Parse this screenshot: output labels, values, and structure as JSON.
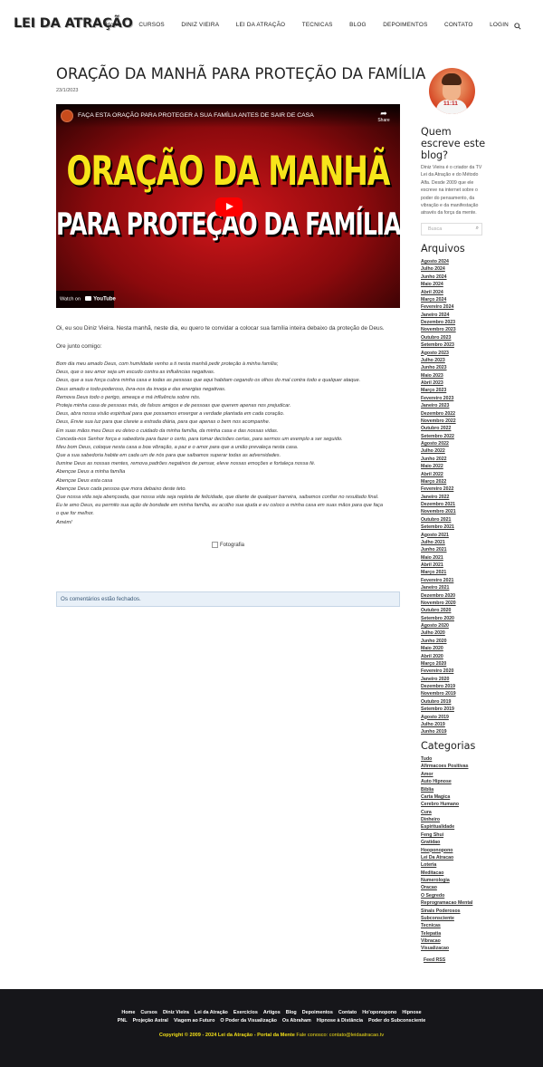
{
  "header": {
    "logo": "LEI DA ATRAÇÃO",
    "nav": [
      "Home",
      "CURSOS",
      "DINIZ VIEIRA",
      "LEI DA ATRAÇÃO",
      "TECNICAS",
      "BLOG",
      "DEPOIMENTOS",
      "CONTATO",
      "LOGIN"
    ],
    "search_icon": "search-icon"
  },
  "post": {
    "title": "ORAÇÃO DA MANHÃ PARA PROTEÇÃO DA FAMÍLIA",
    "date": "23/1/2023",
    "video": {
      "caption": "FAÇA ESTA ORAÇÃO PARA PROTEGER A SUA FAMÍLIA ANTES DE SAIR DE CASA",
      "share_label": "Share",
      "thumb_line1": "ORAÇÃO DA MANHÃ",
      "thumb_line2": "PARA PROTEÇAO DA FAMÍLIA",
      "watch_on": "Watch on",
      "youtube": "YouTube"
    },
    "intro": "Oi, eu sou Diniz Vieira. Nesta manhã, neste dia, eu quero te convidar a colocar sua família inteira debaixo da proteção de Deus.",
    "intro2": "Ore junto comigo:",
    "prayer": [
      "Bom dia meu amado Deus, com humildade venho a ti nesta manhã pedir proteção à minha família;",
      "Deus, que o seu amor seja um escudo contra as influências negativas.",
      "Deus, que a sua força cubra minha casa e todas as pessoas que aqui habitam cegando os olhos do mal contra todo e qualquer ataque.",
      "Deus amado e todo-poderoso, livra-nos da inveja e das energias negativas.",
      "Remova Deus todo o perigo, ameaça e má influência sobre nós.",
      "Proteja minha casa de pessoas más, de falsos amigos e de pessoas que querem apenas nos prejudicar.",
      "Deus, abra nossa visão espiritual para que possamos enxergar a verdade plantada em cada coração.",
      "Deus, Envie sua luz para que clareie a estrada diária, para que apenas o bem nos acompanhe.",
      "Em suas mãos meu Deus eu deixo o cuidado da minha família, da minha casa e das nossas vidas.",
      "Conceda-nos Senhor força e sabedoria para fazer o certo, para tomar decisões certas, para sermos um exemplo a ser seguido.",
      "Meu bom Deus, coloque nesta casa a boa vibração, a paz e o amor para que a união prevaleça nesta casa.",
      "Que a sua sabedoria habite em cada um de nós para que saibamos superar todas as adversidades.",
      "Ilumine Deus as nossas mentes, remova padrões negativos de pensar, eleve nossas emoções e fortaleça nossa fé.",
      "Abençoe Deus a minha família",
      "Abençoe Deus esta casa",
      "Abençoe Deus cada pessoa que mora debaixo deste teto.",
      "Que nossa vida seja abençoada, que nossa vida seja repleta de felicidade, que diante de qualquer barreira, saibamos confiar no resultado final.",
      "Eu te amo Deus, eu permito sua ação de bondade em minha família, eu acolho sua ajuda e eu coloco a minha casa em suas mãos para que faça",
      "o que for melhor.",
      "Amém!"
    ],
    "photo_alt": "Fotografia",
    "comments_closed": "Os comentários estão fechados."
  },
  "sidebar": {
    "author_badge": "11:11",
    "about_title": "Quem escreve este blog?",
    "about_text": "Diniz Vieira é o criador da TV Lei da Atração e do Método Alfa. Desde 2009 que ele escreve na internet sobre o poder do pensamento, da vibração e da manifestação através da força da mente.",
    "search_placeholder": "Busca",
    "archives_title": "Arquivos",
    "archives": [
      "Agosto 2024",
      "Julho 2024",
      "Junho 2024",
      "Maio 2024",
      "Abril 2024",
      "Março 2024",
      "Fevereiro 2024",
      "Janeiro 2024",
      "Dezembro 2023",
      "Novembro 2023",
      "Outubro 2023",
      "Setembro 2023",
      "Agosto 2023",
      "Julho 2023",
      "Junho 2023",
      "Maio 2023",
      "Abril 2023",
      "Março 2023",
      "Fevereiro 2023",
      "Janeiro 2023",
      "Dezembro 2022",
      "Novembro 2022",
      "Outubro 2022",
      "Setembro 2022",
      "Agosto 2022",
      "Julho 2022",
      "Junho 2022",
      "Maio 2022",
      "Abril 2022",
      "Março 2022",
      "Fevereiro 2022",
      "Janeiro 2022",
      "Dezembro 2021",
      "Novembro 2021",
      "Outubro 2021",
      "Setembro 2021",
      "Agosto 2021",
      "Julho 2021",
      "Junho 2021",
      "Maio 2021",
      "Abril 2021",
      "Março 2021",
      "Fevereiro 2021",
      "Janeiro 2021",
      "Dezembro 2020",
      "Novembro 2020",
      "Outubro 2020",
      "Setembro 2020",
      "Agosto 2020",
      "Julho 2020",
      "Junho 2020",
      "Maio 2020",
      "Abril 2020",
      "Março 2020",
      "Fevereiro 2020",
      "Janeiro 2020",
      "Dezembro 2019",
      "Novembro 2019",
      "Outubro 2019",
      "Setembro 2019",
      "Agosto 2019",
      "Julho 2019",
      "Junho 2019"
    ],
    "categories_title": "Categorias",
    "categories": [
      "Tudo",
      "Afirmacoes Positivas",
      "Amor",
      "Auto Hipnose",
      "Biblia",
      "Carta Magica",
      "Cerebro Humano",
      "Cura",
      "Dinheiro",
      "Espiritualidade",
      "Feng Shui",
      "Gratidao",
      "Hooponopono",
      "Lei Da Atracao",
      "Loteria",
      "Meditacao",
      "Numerologia",
      "Oracao",
      "O Segredo",
      "Reprogramacao Mental",
      "Sinais Poderosos",
      "Subconsciente",
      "Tecnicas",
      "Telepatia",
      "Vibracao",
      "Visualizacao"
    ],
    "feed": "Feed RSS"
  },
  "footer": {
    "nav_row1": [
      "Home",
      "Cursos",
      "Diniz Vieira",
      "Lei da Atração",
      "Exercícios",
      "Artigos",
      "Blog",
      "Depoimentos",
      "Contato",
      "Ho'oponopono",
      "Hipnose"
    ],
    "nav_row2": [
      "PNL",
      "Projeção Astral",
      "Viagem ao Futuro",
      "O Poder da Visualização",
      "Os Abraham",
      "Hipnose à Distância",
      "Poder do Subconsciente"
    ],
    "copyright": "Copyright © 2009 - 2024 Lei da Atração - Portal da Mente",
    "contact": "Fale conosco: contato@leidaatracao.tv"
  }
}
